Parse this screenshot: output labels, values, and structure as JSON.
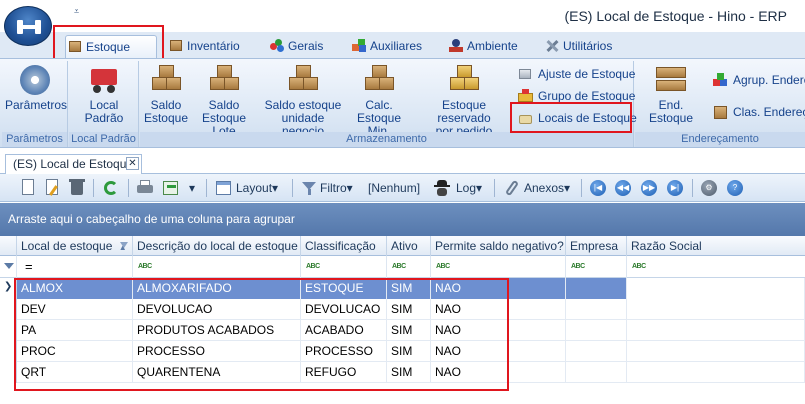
{
  "window": {
    "title": "(ES) Local de Estoque - Hino - ERP",
    "qat_glyph": "⩡"
  },
  "ribbon_tabs": [
    {
      "label": "Estoque"
    },
    {
      "label": "Inventário"
    },
    {
      "label": "Gerais"
    },
    {
      "label": "Auxiliares"
    },
    {
      "label": "Ambiente"
    },
    {
      "label": "Utilitários"
    }
  ],
  "ribbon": {
    "groups": {
      "parametros": "Parâmetros",
      "local_padrao": "Local Padrão",
      "armazenamento": "Armazenamento",
      "enderecamento": "Endereçamento"
    },
    "buttons": {
      "parametros": "Parâmetros",
      "local_padrao": "Local\nPadrão",
      "saldo_estoque": "Saldo\nEstoque",
      "saldo_estoque_lote": "Saldo\nEstoque Lote",
      "saldo_unidade": "Saldo estoque\nunidade negocio",
      "calc_estoque_min": "Calc.\nEstoque Min.",
      "estoque_reservado": "Estoque reservado\npor pedido",
      "ajuste_estoque": "Ajuste de Estoque",
      "grupo_estoque": "Grupo de Estoque",
      "locais_estoque": "Locais de Estoque",
      "end_estoque": "End. Estoque",
      "agrup_endereco": "Agrup. Endere",
      "clas_endereco": "Clas. Endereço"
    }
  },
  "document_tab": {
    "label": "(ES) Local de Estoque",
    "close": "✕"
  },
  "toolbar": {
    "layout": "Layout",
    "filtro": "Filtro",
    "filter_value": "[Nenhum]",
    "log": "Log",
    "anexos": "Anexos",
    "dropdown": "▾"
  },
  "group_panel_text": "Arraste aqui o cabeçalho de uma coluna para agrupar",
  "grid": {
    "columns": [
      {
        "label": "Local de estoque"
      },
      {
        "label": "Descrição do local de estoque"
      },
      {
        "label": "Classificação"
      },
      {
        "label": "Ativo"
      },
      {
        "label": "Permite saldo negativo?"
      },
      {
        "label": "Empresa"
      },
      {
        "label": "Razão Social"
      }
    ],
    "sort_glyph": "▲",
    "filter_operator": "=",
    "abc_label": "ABC",
    "current_row_marker": "❯",
    "rows": [
      [
        "ALMOX",
        "ALMOXARIFADO",
        "ESTOQUE",
        "SIM",
        "NAO",
        "",
        ""
      ],
      [
        "DEV",
        "DEVOLUCAO",
        "DEVOLUCAO",
        "SIM",
        "NAO",
        "",
        ""
      ],
      [
        "PA",
        "PRODUTOS ACABADOS",
        "ACABADO",
        "SIM",
        "NAO",
        "",
        ""
      ],
      [
        "PROC",
        "PROCESSO",
        "PROCESSO",
        "SIM",
        "NAO",
        "",
        ""
      ],
      [
        "QRT",
        "QUARENTENA",
        "REFUGO",
        "SIM",
        "NAO",
        "",
        ""
      ]
    ]
  }
}
